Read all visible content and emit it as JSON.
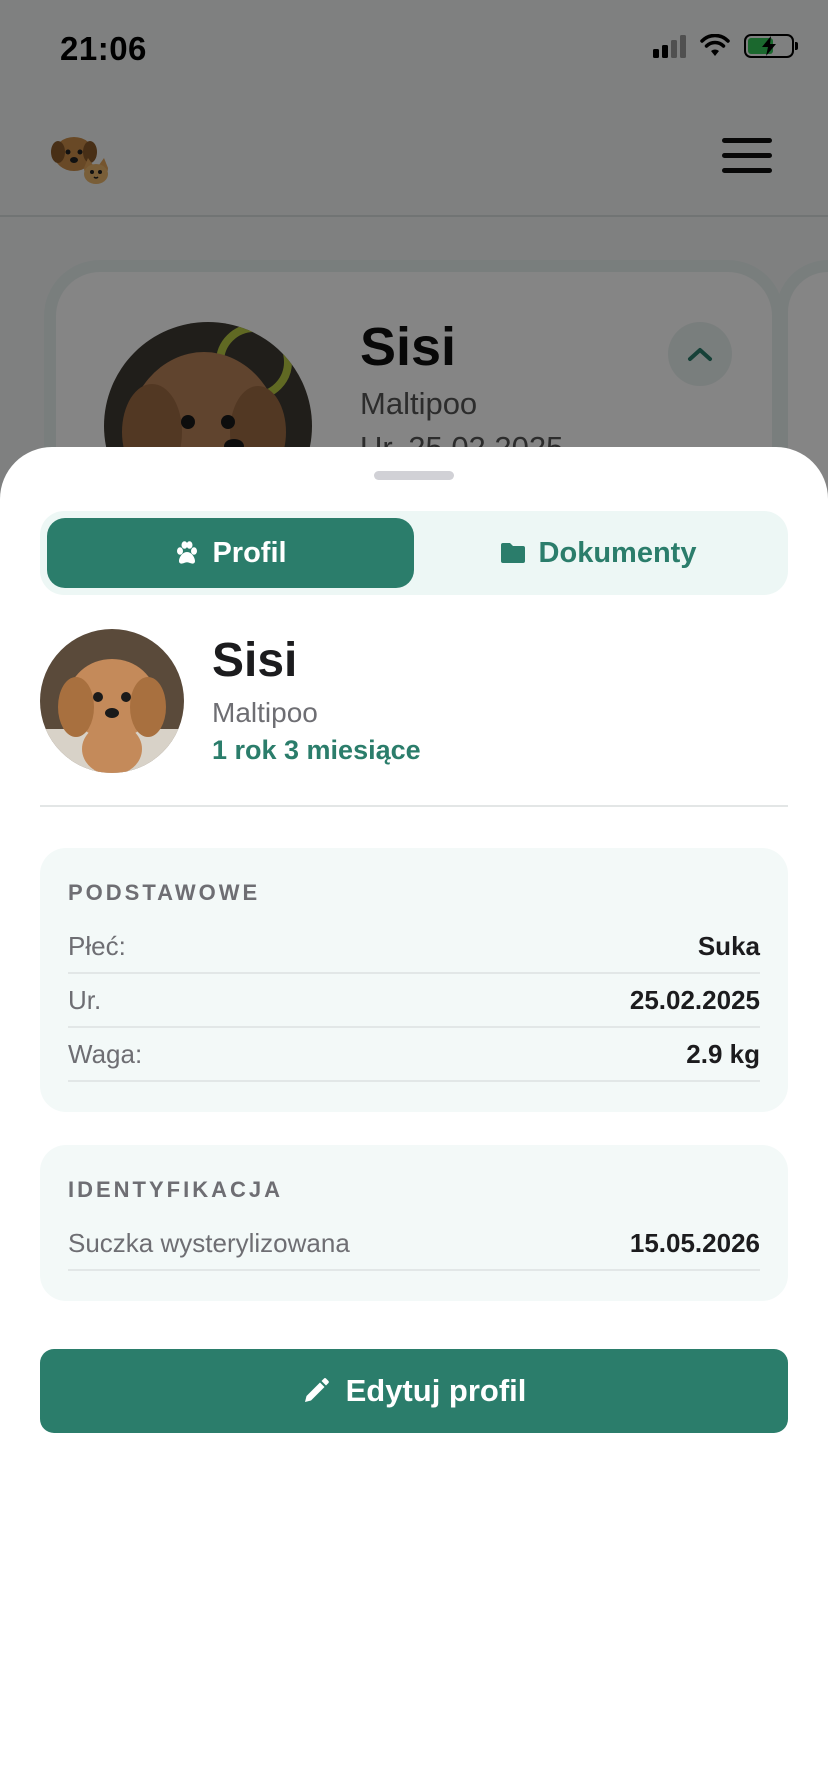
{
  "status_bar": {
    "time": "21:06",
    "signal_icon": "cellular-signal-icon",
    "wifi_icon": "wifi-icon",
    "battery_icon": "battery-charging-icon",
    "battery_level": 0.6,
    "battery_color": "#34c759"
  },
  "header": {
    "logo_icon": "dog-and-cat-logo",
    "menu_icon": "hamburger-menu-icon"
  },
  "background_card": {
    "name": "Sisi",
    "breed": "Maltipoo",
    "dob": "Ur. 25.02.2025",
    "collapse_icon": "chevron-up-icon"
  },
  "sheet": {
    "tabs": [
      {
        "label": "Profil",
        "icon": "paw-icon",
        "active": true
      },
      {
        "label": "Dokumenty",
        "icon": "folder-icon",
        "active": false
      }
    ],
    "pet": {
      "name": "Sisi",
      "breed": "Maltipoo",
      "age": "1 rok 3 miesiące"
    },
    "basic": {
      "title": "PODSTAWOWE",
      "rows": [
        {
          "label": "Płeć:",
          "value": "Suka"
        },
        {
          "label": "Ur.",
          "value": "25.02.2025"
        },
        {
          "label": "Waga:",
          "value": "2.9 kg"
        }
      ]
    },
    "identification": {
      "title": "IDENTYFIKACJA",
      "rows": [
        {
          "label": "Suczka wysterylizowana",
          "value": "15.05.2026"
        }
      ]
    },
    "edit_button": {
      "label": "Edytuj profil",
      "icon": "pencil-icon"
    }
  },
  "colors": {
    "accent": "#2b7d6b",
    "accent_light": "#edf7f5",
    "card_bg": "#f3f9f8"
  }
}
